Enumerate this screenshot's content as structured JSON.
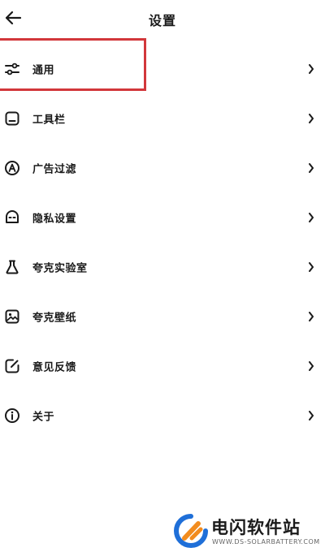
{
  "header": {
    "title": "设置",
    "back_icon": "arrow-left-icon"
  },
  "menu": [
    {
      "label": "通用",
      "icon": "sliders-icon",
      "highlighted": true
    },
    {
      "label": "工具栏",
      "icon": "toolbar-icon"
    },
    {
      "label": "广告过滤",
      "icon": "ad-filter-icon"
    },
    {
      "label": "隐私设置",
      "icon": "privacy-mask-icon"
    },
    {
      "label": "夸克实验室",
      "icon": "flask-icon"
    },
    {
      "label": "夸克壁纸",
      "icon": "wallpaper-icon"
    },
    {
      "label": "意见反馈",
      "icon": "feedback-edit-icon"
    },
    {
      "label": "关于",
      "icon": "info-icon"
    }
  ],
  "colors": {
    "highlight_border": "#d2373b",
    "text": "#1a1a1a",
    "logo_blue": "#1f6fd8",
    "logo_orange": "#f28c1e"
  },
  "watermark": {
    "title": "电闪软件站",
    "url": "WWW.DS-SOLARBATTERY.COM"
  }
}
